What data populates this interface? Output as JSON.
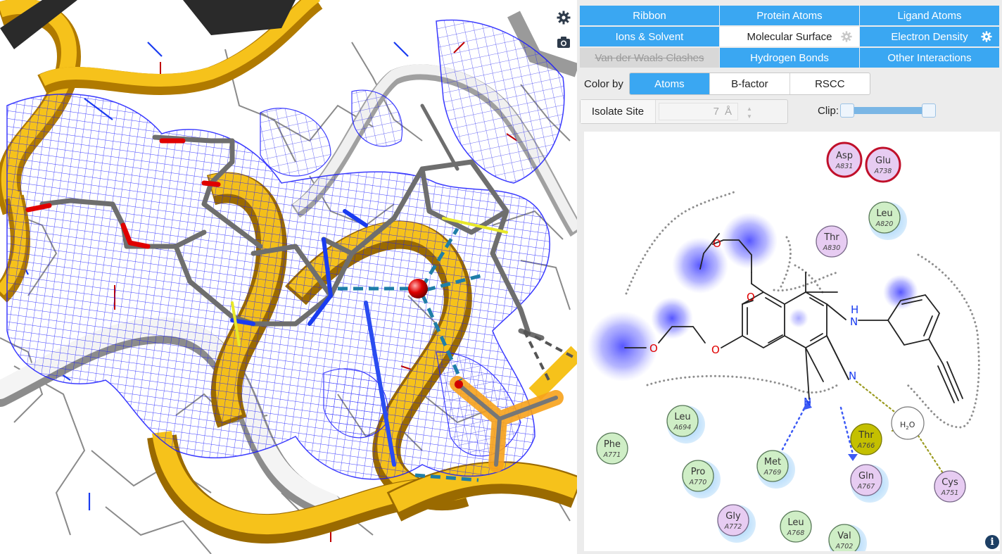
{
  "viewer": {
    "settings_icon": "gear-icon",
    "camera_icon": "camera-icon"
  },
  "toggles": [
    {
      "label": "Ribbon",
      "state": "on"
    },
    {
      "label": "Protein Atoms",
      "state": "on"
    },
    {
      "label": "Ligand Atoms",
      "state": "on"
    },
    {
      "label": "Ions & Solvent",
      "state": "on"
    },
    {
      "label": "Molecular Surface",
      "state": "off",
      "gear": true
    },
    {
      "label": "Electron Density",
      "state": "on",
      "gear": true
    },
    {
      "label": "Van der Waals Clashes",
      "state": "disabled"
    },
    {
      "label": "Hydrogen Bonds",
      "state": "on"
    },
    {
      "label": "Other Interactions",
      "state": "on"
    }
  ],
  "color_by": {
    "label": "Color by",
    "options": [
      "Atoms",
      "B-factor",
      "RSCC"
    ],
    "selected": "Atoms"
  },
  "isolate_site": {
    "label": "Isolate Site",
    "value": "7",
    "unit": "Å"
  },
  "clip": {
    "label": "Clip:",
    "range_fraction": [
      0.0,
      1.0
    ]
  },
  "diagram": {
    "ligand_labels": {
      "nh": "N",
      "h": "H",
      "n1": "N",
      "n2": "N",
      "o1": "O",
      "o2": "O",
      "o3": "O",
      "o4": "O"
    },
    "water": {
      "label": "H",
      "sub": "2",
      "tail": "O"
    },
    "residues": [
      {
        "name": "Asp",
        "num": "A831",
        "kind": "acidic"
      },
      {
        "name": "Glu",
        "num": "A738",
        "kind": "acidic"
      },
      {
        "name": "Leu",
        "num": "A820",
        "kind": "hydrophobic"
      },
      {
        "name": "Thr",
        "num": "A830",
        "kind": "polar"
      },
      {
        "name": "Leu",
        "num": "A694",
        "kind": "hydrophobic"
      },
      {
        "name": "Phe",
        "num": "A771",
        "kind": "hydrophobic"
      },
      {
        "name": "Pro",
        "num": "A770",
        "kind": "hydrophobic"
      },
      {
        "name": "Met",
        "num": "A769",
        "kind": "hydrophobic"
      },
      {
        "name": "Thr",
        "num": "A766",
        "kind": "highlighted"
      },
      {
        "name": "Gln",
        "num": "A767",
        "kind": "polar"
      },
      {
        "name": "Cys",
        "num": "A751",
        "kind": "polar"
      },
      {
        "name": "Gly",
        "num": "A772",
        "kind": "polar"
      },
      {
        "name": "Leu",
        "num": "A768",
        "kind": "hydrophobic"
      },
      {
        "name": "Val",
        "num": "A702",
        "kind": "hydrophobic"
      }
    ],
    "info_icon": "info-icon",
    "info_glyph": "i"
  },
  "colors": {
    "accent": "#3aa7f2",
    "ribbon": "#f2b705",
    "density": "#1a1aff",
    "acidic_ring": "#c0102a",
    "hydrophobic_fill": "#cfeec6",
    "polar_fill": "#e7ccf2",
    "highlight_fill": "#c4c000"
  }
}
